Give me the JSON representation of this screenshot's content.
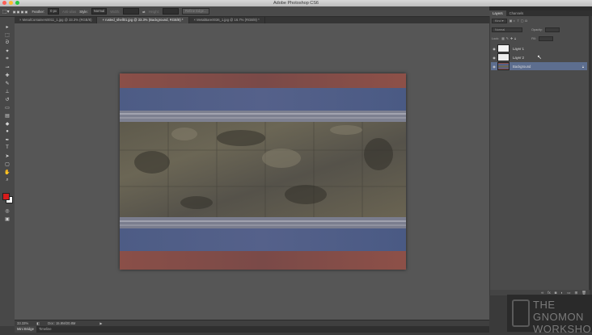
{
  "app": {
    "window_title": "Adobe Photoshop CS6"
  },
  "options_bar": {
    "feather_label": "Feather:",
    "feather_value": "0 px",
    "anti_alias_label": "Anti-alias",
    "style_label": "Style:",
    "style_value": "Normal",
    "width_label": "Width:",
    "height_label": "Height:",
    "refine_edge_label": "Refine Edge..."
  },
  "document_tabs": [
    {
      "label": "× MetalContainers0011_1.jpg @ 33.3% (RGB/8)"
    },
    {
      "label": "× rusted_shell01.jpg @ 33.3% (Background, RGB/8) *"
    },
    {
      "label": "× MetalBare0036_1.jpg @ 16.7% (RGB/8) *"
    }
  ],
  "toolbar": {
    "tools": [
      {
        "name": "move-tool-icon",
        "glyph": "▸"
      },
      {
        "name": "marquee-tool-icon",
        "glyph": "⬚"
      },
      {
        "name": "lasso-tool-icon",
        "glyph": "ᘐ"
      },
      {
        "name": "magic-wand-tool-icon",
        "glyph": "✦"
      },
      {
        "name": "crop-tool-icon",
        "glyph": "⌗"
      },
      {
        "name": "eyedropper-tool-icon",
        "glyph": "⊸"
      },
      {
        "name": "healing-brush-tool-icon",
        "glyph": "✚"
      },
      {
        "name": "brush-tool-icon",
        "glyph": "✎"
      },
      {
        "name": "clone-stamp-tool-icon",
        "glyph": "⊥"
      },
      {
        "name": "history-brush-tool-icon",
        "glyph": "↺"
      },
      {
        "name": "eraser-tool-icon",
        "glyph": "▭"
      },
      {
        "name": "gradient-tool-icon",
        "glyph": "▤"
      },
      {
        "name": "blur-tool-icon",
        "glyph": "◆"
      },
      {
        "name": "dodge-tool-icon",
        "glyph": "●"
      },
      {
        "name": "pen-tool-icon",
        "glyph": "✒"
      },
      {
        "name": "type-tool-icon",
        "glyph": "T"
      },
      {
        "name": "path-selection-tool-icon",
        "glyph": "➤"
      },
      {
        "name": "shape-tool-icon",
        "glyph": "▢"
      },
      {
        "name": "hand-tool-icon",
        "glyph": "✋"
      },
      {
        "name": "zoom-tool-icon",
        "glyph": "⌕"
      }
    ],
    "foreground_color": "#d71b1b",
    "background_color": "#ffffff"
  },
  "status_bar": {
    "zoom": "33.33%",
    "doc_info": "Doc: 15.9M/20.8M"
  },
  "bottom_tabs": [
    {
      "label": "Mini Bridge"
    },
    {
      "label": "Timeline"
    }
  ],
  "layers_panel": {
    "tabs": [
      {
        "label": "Layers"
      },
      {
        "label": "Channels"
      }
    ],
    "kind_label": "Kind",
    "blend_mode": "Normal",
    "opacity_label": "Opacity:",
    "lock_label": "Lock:",
    "fill_label": "Fill:",
    "layers": [
      {
        "name": "Layer 1",
        "visible": true,
        "selected": false
      },
      {
        "name": "Layer 2",
        "visible": true,
        "selected": false
      },
      {
        "name": "Background",
        "visible": true,
        "selected": true,
        "locked": true
      }
    ]
  },
  "watermark": {
    "text_line1": "THE GNOMON",
    "text_line2": "WORKSHOP"
  }
}
